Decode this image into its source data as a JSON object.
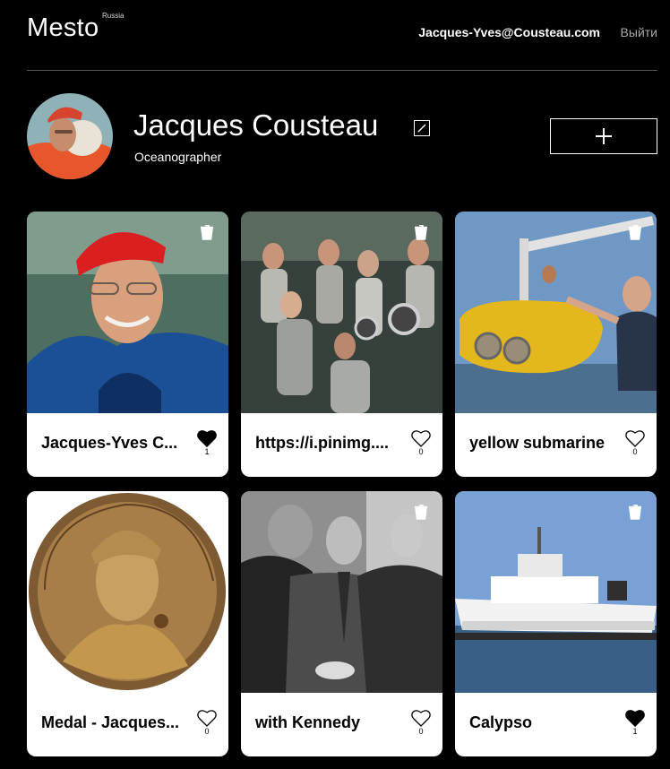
{
  "header": {
    "logo": "Mesto",
    "logo_sub": "Russia",
    "email": "Jacques-Yves@Cousteau.com",
    "logout": "Выйти"
  },
  "profile": {
    "name": "Jacques Cousteau",
    "job": "Oceanographer"
  },
  "cards": [
    {
      "title": "Jacques-Yves C...",
      "likes": "1",
      "liked": true
    },
    {
      "title": "https://i.pinimg....",
      "likes": "0",
      "liked": false
    },
    {
      "title": "yellow submarine",
      "likes": "0",
      "liked": false
    },
    {
      "title": "Medal - Jacques...",
      "likes": "0",
      "liked": false
    },
    {
      "title": "with Kennedy",
      "likes": "0",
      "liked": false
    },
    {
      "title": "Calypso",
      "likes": "1",
      "liked": true
    }
  ],
  "colors": {
    "background": "#000000",
    "card": "#ffffff",
    "divider": "#545454",
    "muted": "#a9a9a9"
  },
  "icons": {
    "edit": "pencil-icon",
    "add": "plus-icon",
    "delete": "trash-icon",
    "like": "heart-icon"
  }
}
